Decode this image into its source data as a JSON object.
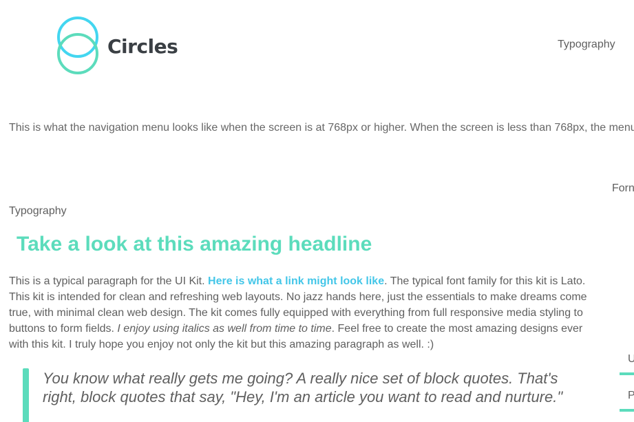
{
  "brand": {
    "name": "Circles",
    "logo_icon": "two-circles-logo-icon",
    "colors": {
      "cyan": "#43c6e8",
      "teal": "#5cdcbc"
    }
  },
  "nav": {
    "typography_label": "Typography",
    "note": "This is what the navigation menu looks like when the screen is at 768px or higher. When the screen is less than 768px, the menu",
    "form_partial": "Forn"
  },
  "content": {
    "section_label": "Typography",
    "headline": "Take a look at this amazing headline",
    "paragraph": {
      "text1": "This is a typical paragraph for the UI Kit. ",
      "link": "Here is what a link might look like",
      "text2": ". The typical font family for this kit is Lato. This kit is intended for clean and refreshing web layouts. No jazz hands here, just the essentials to make dreams come true, with minimal clean web design. The kit comes fully equipped with everything from full responsive media styling to buttons to form fields. ",
      "italic": "I enjoy using italics as well from time to time",
      "text3": ". Feel free to create the most amazing designs ever with this kit. I truly hope you enjoy not only the kit but this amazing paragraph as well. :)"
    },
    "blockquote": "You know what really gets me going? A really nice set of block quotes. That's right, block quotes that say, \"Hey, I'm an article you want to read and nurture.\""
  },
  "side_panel": {
    "frag_u": "U",
    "frag_p": "P"
  }
}
